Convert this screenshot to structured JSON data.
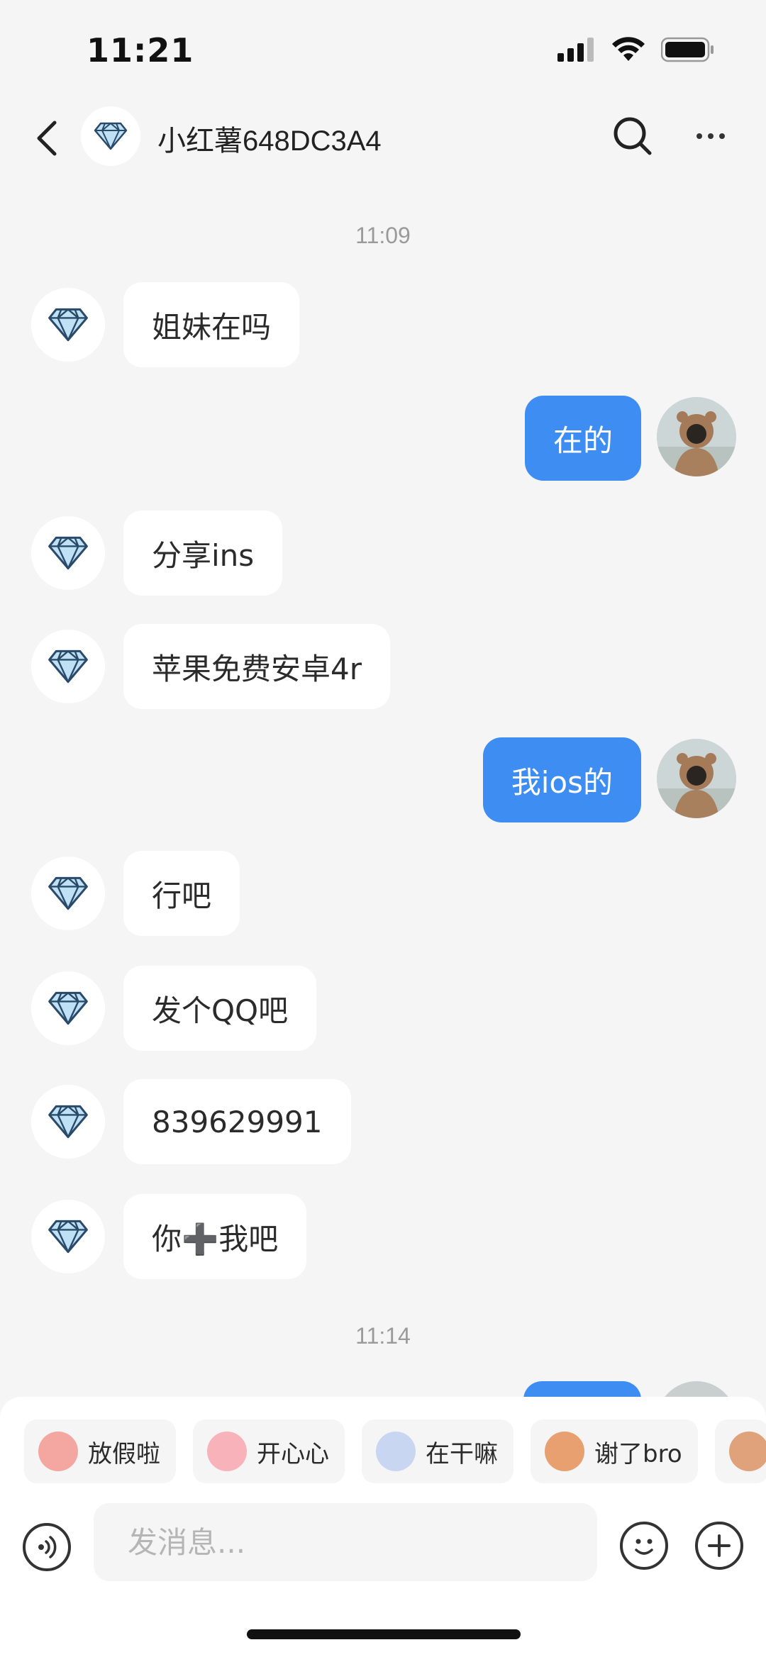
{
  "status_bar": {
    "time": "11:21"
  },
  "header": {
    "title": "小红薯648DC3A4",
    "back_icon": "back-chevron-icon",
    "search_icon": "search-icon",
    "more_icon": "more-dots-icon"
  },
  "messages": [
    {
      "type": "timestamp",
      "text": "11:09"
    },
    {
      "side": "left",
      "text": "姐妹在吗"
    },
    {
      "side": "right",
      "text": "在的"
    },
    {
      "side": "left",
      "text": "分享ins"
    },
    {
      "side": "left",
      "text": "苹果免费安卓4r"
    },
    {
      "side": "right",
      "text": "我ios的"
    },
    {
      "side": "left",
      "text": "行吧"
    },
    {
      "side": "left",
      "text": "发个QQ吧"
    },
    {
      "side": "left",
      "text": "839629991"
    },
    {
      "side": "left",
      "text": "你➕我吧"
    },
    {
      "type": "timestamp",
      "text": "11:14"
    }
  ],
  "stickers": [
    {
      "label": "放假啦",
      "color": "#f4a6a0"
    },
    {
      "label": "开心心",
      "color": "#f7b3b9"
    },
    {
      "label": "在干嘛",
      "color": "#c9d6f2"
    },
    {
      "label": "谢了bro",
      "color": "#e8a070"
    }
  ],
  "composer": {
    "placeholder": "发消息..."
  },
  "colors": {
    "accent": "#3e8df3",
    "background": "#f5f5f5",
    "bubble_left": "#ffffff"
  }
}
